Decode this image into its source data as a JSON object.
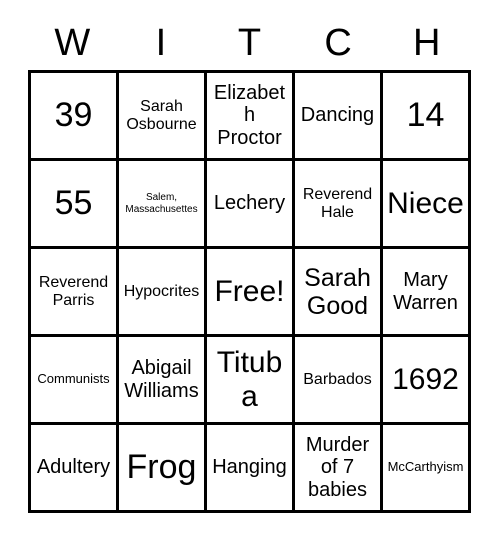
{
  "card": {
    "header_letters": [
      "W",
      "I",
      "T",
      "C",
      "H"
    ],
    "columns": 5,
    "rows": 5,
    "grid_line_color": "#000000",
    "background_color": "#ffffff",
    "text_color": "#000000",
    "cells": [
      {
        "text": "39",
        "size": "xxl"
      },
      {
        "text": "Sarah Osbourne",
        "size": "sm"
      },
      {
        "text": "Elizabeth Proctor",
        "size": "md"
      },
      {
        "text": "Dancing",
        "size": "md"
      },
      {
        "text": "14",
        "size": "xxl"
      },
      {
        "text": "55",
        "size": "xxl"
      },
      {
        "text": "Salem, Massachusettes",
        "size": "xxs"
      },
      {
        "text": "Lechery",
        "size": "md"
      },
      {
        "text": "Reverend Hale",
        "size": "sm"
      },
      {
        "text": "Niece",
        "size": "xl"
      },
      {
        "text": "Reverend Parris",
        "size": "sm"
      },
      {
        "text": "Hypocrites",
        "size": "sm"
      },
      {
        "text": "Free!",
        "size": "xl"
      },
      {
        "text": "Sarah Good",
        "size": "lg"
      },
      {
        "text": "Mary Warren",
        "size": "md"
      },
      {
        "text": "Communists",
        "size": "xs"
      },
      {
        "text": "Abigail Williams",
        "size": "md"
      },
      {
        "text": "Tituba",
        "size": "xl"
      },
      {
        "text": "Barbados",
        "size": "sm"
      },
      {
        "text": "1692",
        "size": "xl"
      },
      {
        "text": "Adultery",
        "size": "md"
      },
      {
        "text": "Frog",
        "size": "xxl"
      },
      {
        "text": "Hanging",
        "size": "md"
      },
      {
        "text": "Murder of 7 babies",
        "size": "md"
      },
      {
        "text": "McCarthyism",
        "size": "xs"
      }
    ]
  }
}
